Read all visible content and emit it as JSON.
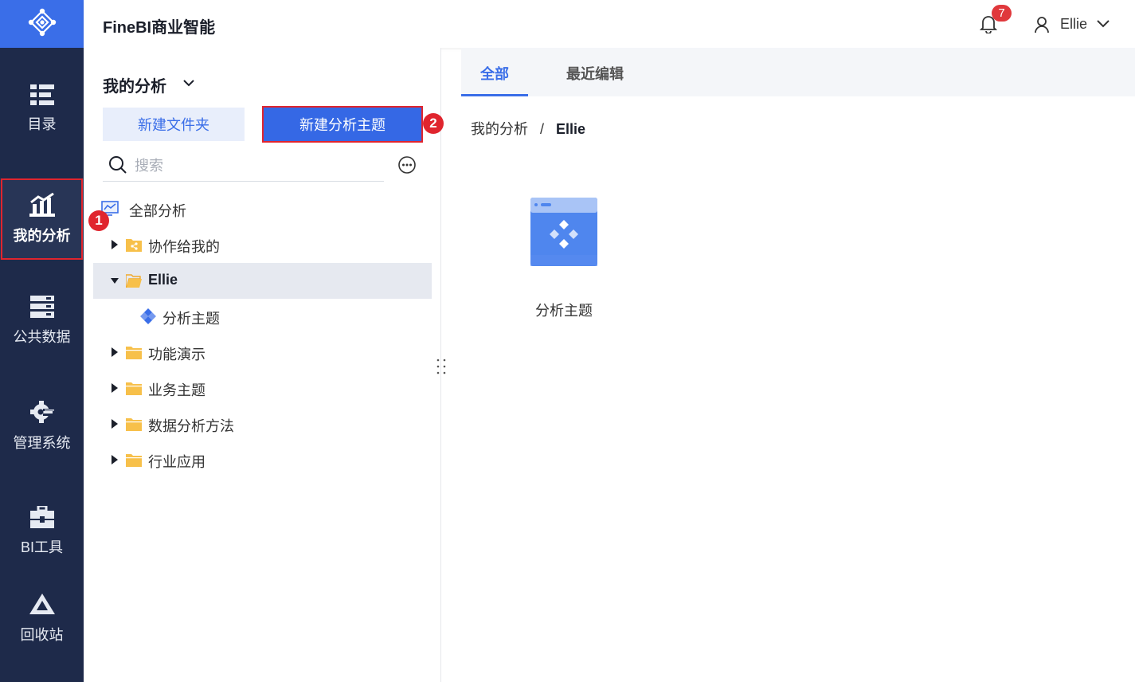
{
  "app": {
    "title": "FineBI商业智能"
  },
  "header": {
    "notification_count": "7",
    "user_name": "Ellie"
  },
  "leftnav": {
    "items": [
      {
        "label": "目录",
        "icon": "catalog-icon"
      },
      {
        "label": "我的分析",
        "icon": "my-analysis-icon",
        "active": true
      },
      {
        "label": "公共数据",
        "icon": "public-data-icon"
      },
      {
        "label": "管理系统",
        "icon": "gear-icon"
      },
      {
        "label": "BI工具",
        "icon": "toolbox-icon"
      },
      {
        "label": "回收站",
        "icon": "recycle-icon"
      }
    ]
  },
  "panel": {
    "title": "我的分析",
    "new_folder_label": "新建文件夹",
    "new_subject_label": "新建分析主题",
    "search_placeholder": "搜索",
    "tree": [
      {
        "label": "全部分析",
        "icon": "all-analysis-icon"
      },
      {
        "label": "协作给我的",
        "icon": "shared-folder-icon",
        "collapsed": true
      },
      {
        "label": "Ellie",
        "icon": "folder-open-icon",
        "expanded": true,
        "selected": true
      },
      {
        "label": "分析主题",
        "icon": "analysis-subject-icon",
        "child": true
      },
      {
        "label": "功能演示",
        "icon": "folder-icon",
        "collapsed": true
      },
      {
        "label": "业务主题",
        "icon": "folder-icon",
        "collapsed": true
      },
      {
        "label": "数据分析方法",
        "icon": "folder-icon",
        "collapsed": true
      },
      {
        "label": "行业应用",
        "icon": "folder-icon",
        "collapsed": true
      }
    ]
  },
  "content": {
    "tabs": [
      {
        "label": "全部",
        "active": true
      },
      {
        "label": "最近编辑"
      }
    ],
    "breadcrumb": {
      "root": "我的分析",
      "separator": "/",
      "current": "Ellie"
    },
    "items": [
      {
        "label": "分析主题",
        "icon": "analysis-subject-large-icon"
      }
    ]
  },
  "annotations": {
    "step1": "1",
    "step2": "2"
  },
  "colors": {
    "nav_bg": "#1e2a4a",
    "accent": "#3a6ee8",
    "annotation_red": "#e0252e",
    "folder": "#f7c04a"
  }
}
